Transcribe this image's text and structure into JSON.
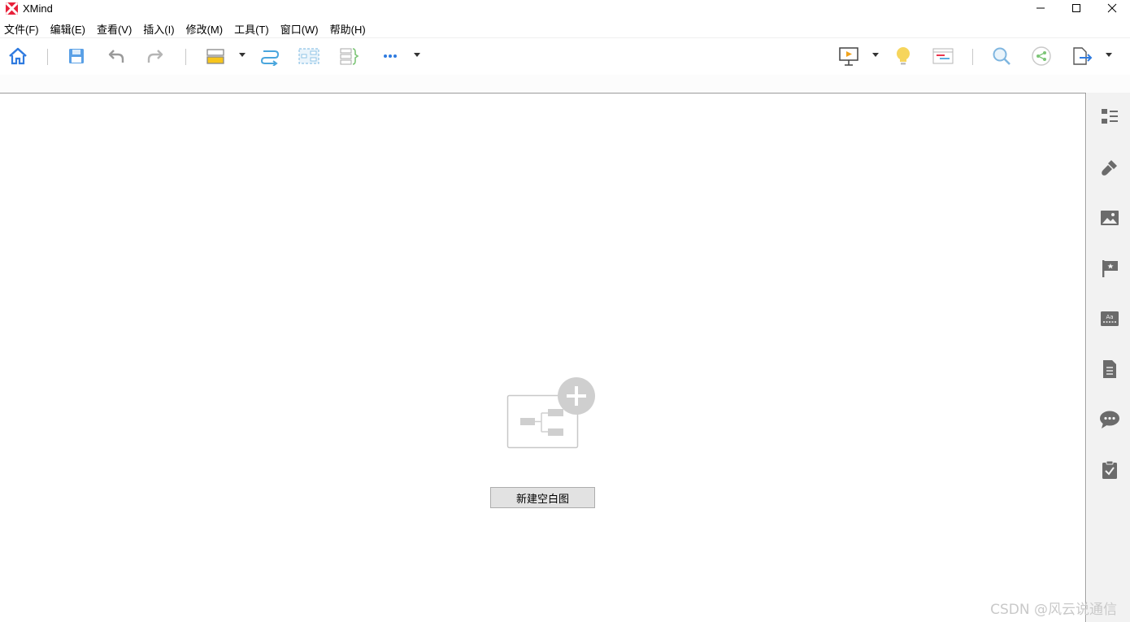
{
  "window": {
    "title": "XMind"
  },
  "menu": {
    "items": [
      "文件(F)",
      "编辑(E)",
      "查看(V)",
      "插入(I)",
      "修改(M)",
      "工具(T)",
      "窗口(W)",
      "帮助(H)"
    ]
  },
  "toolbar": {
    "icons": [
      "home-icon",
      "save-icon",
      "undo-icon",
      "redo-icon",
      "topic-icon",
      "relationship-icon",
      "boundary-icon",
      "summary-icon",
      "more-icon",
      "presentation-icon",
      "idea-icon",
      "gantt-icon",
      "search-icon",
      "share-icon",
      "export-icon"
    ]
  },
  "workspace": {
    "new_blank_label": "新建空白图"
  },
  "side_panel": {
    "icons": [
      "outline-icon",
      "format-brush-icon",
      "image-icon",
      "marker-flag-icon",
      "text-format-icon",
      "notes-icon",
      "comments-icon",
      "task-icon"
    ]
  },
  "watermark": "CSDN @风云说通信",
  "colors": {
    "accent_blue": "#2f7be0",
    "logo_red": "#e8213a",
    "panel_bg": "#f2f2f2"
  }
}
